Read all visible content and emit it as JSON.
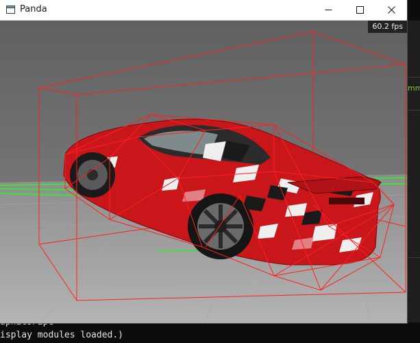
{
  "window": {
    "title": "Panda",
    "icon": "app-window-icon",
    "controls": [
      "minimize-icon",
      "maximize-icon",
      "close-icon"
    ]
  },
  "viewport": {
    "fps_text": "60.2 fps",
    "sky_color": "#6b6b6b",
    "ground_color": "#9c9c9c",
    "bounds_color": "#ff2020",
    "car_color": "#c8161a"
  },
  "console": {
    "line_1": "aphicsPipe",
    "line_2": "isplay modules loaded.)",
    "side_fragment": "mme"
  }
}
